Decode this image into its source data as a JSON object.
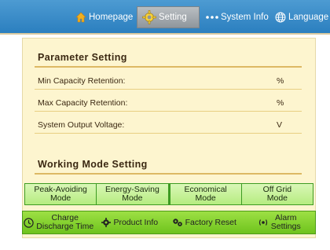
{
  "nav": {
    "home_label": "Homepage",
    "setting_label": "Setting",
    "sysinfo_label": "System Info",
    "language_label": "Language"
  },
  "parameter_setting": {
    "title": "Parameter Setting",
    "rows": [
      {
        "label": "Min Capacity Retention:",
        "unit": "%"
      },
      {
        "label": "Max Capacity Retention:",
        "unit": "%"
      },
      {
        "label": "System Output Voltage:",
        "unit": "V"
      }
    ]
  },
  "working_mode": {
    "title": "Working Mode Setting",
    "modes": [
      {
        "line1": "Peak-Avoiding",
        "line2": "Mode"
      },
      {
        "line1": "Energy-Saving",
        "line2": "Mode"
      },
      {
        "line1": "Economical",
        "line2": "Mode"
      },
      {
        "line1": "Off Grid",
        "line2": "Mode"
      }
    ]
  },
  "bottom_bar": {
    "charge_line1": "Charge",
    "charge_line2": "Discharge Time",
    "product_info": "Product Info",
    "factory_reset": "Factory Reset",
    "alarm_line1": "Alarm",
    "alarm_line2": "Settings"
  },
  "icons": {
    "home": "home-icon",
    "setting": "gear-icon",
    "sysinfo": "dots-icon",
    "language": "globe-icon",
    "charge": "clock-icon",
    "product": "gear-icon",
    "factory": "gears-icon",
    "alarm": "alarm-icon"
  },
  "colors": {
    "topbar": "#2b7fbf",
    "panel_bg": "#fdf5cf",
    "mode_green": "#b6ec80",
    "bottom_green": "#6fc31d",
    "active_tab": "#8f969c"
  }
}
